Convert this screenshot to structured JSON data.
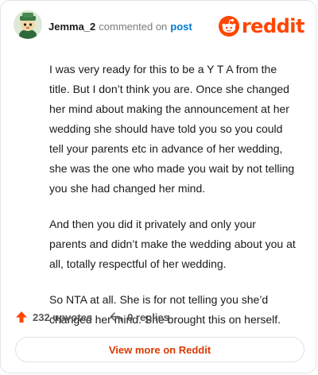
{
  "header": {
    "username": "Jemma_2",
    "middle_text": "commented on",
    "post_link": "post",
    "brand": "reddit"
  },
  "comment": {
    "paragraphs": [
      "I was very ready for this to be a Y T A from the title. But I don’t think you are. Once she changed her mind about making the announcement at her wedding she should have told you so you could tell your parents etc in advance of her wedding, she was the one who made you wait by not telling you she had changed her mind.",
      "And then you did it privately and only your parents and didn’t make the wedding about you at all, totally respectful of her wedding.",
      "So NTA at all. She is for not telling you she’d changed her mind. She brought this on herself."
    ]
  },
  "actions": {
    "upvotes": "232 upvotes",
    "replies": "0 replies"
  },
  "footer": {
    "view_more": "View more on Reddit"
  },
  "colors": {
    "brand": "#ff4500",
    "link": "#0079d3",
    "cta": "#d93a00"
  }
}
